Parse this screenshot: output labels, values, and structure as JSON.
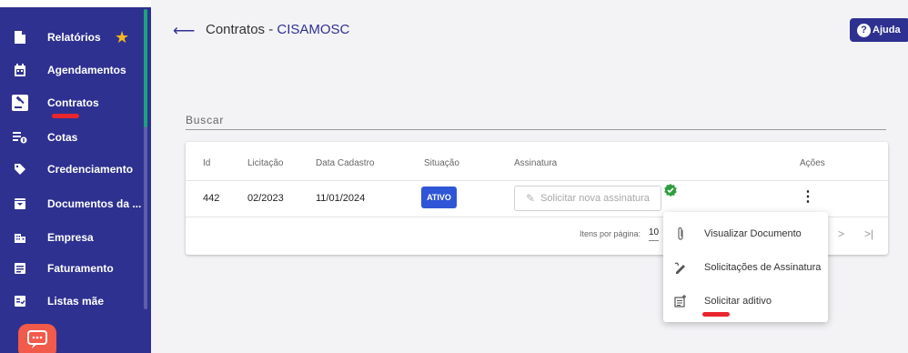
{
  "sidebar": {
    "items": [
      {
        "label": "Relatórios",
        "icon": "report-icon"
      },
      {
        "label": "Agendamentos",
        "icon": "calendar-icon"
      },
      {
        "label": "Contratos",
        "icon": "gavel-icon"
      },
      {
        "label": "Cotas",
        "icon": "quota-icon"
      },
      {
        "label": "Credenciamento",
        "icon": "tag-icon"
      },
      {
        "label": "Documentos da ...",
        "icon": "document-box-icon"
      },
      {
        "label": "Empresa",
        "icon": "building-icon"
      },
      {
        "label": "Faturamento",
        "icon": "invoice-icon"
      },
      {
        "label": "Listas mãe",
        "icon": "checklist-icon"
      }
    ],
    "active": "Contratos",
    "favorite": "Relatórios"
  },
  "header": {
    "title_prefix": "Contratos - ",
    "title_highlight": "CISAMOSC",
    "help_label": "Ajuda"
  },
  "search": {
    "label": "Buscar"
  },
  "table": {
    "columns": [
      "Id",
      "Licitação",
      "Data Cadastro",
      "Situação",
      "Assinatura",
      "Ações"
    ],
    "rows": [
      {
        "id": "442",
        "licitacao": "02/2023",
        "data_cadastro": "11/01/2024",
        "situacao": "ATIVO",
        "assinatura": "Solicitar nova assinatura"
      }
    ],
    "paginator": {
      "label": "Itens por página:",
      "page_size": "10"
    }
  },
  "menu": {
    "items": [
      {
        "label": "Visualizar Documento",
        "icon": "paperclip-icon"
      },
      {
        "label": "Solicitações de Assinatura",
        "icon": "signature-icon"
      },
      {
        "label": "Solicitar aditivo",
        "icon": "add-document-icon"
      }
    ]
  },
  "colors": {
    "sidebar": "#2f3190",
    "accent": "#2f56d6",
    "highlight_underline": "#e8262d",
    "verified": "#2e9d3f"
  }
}
